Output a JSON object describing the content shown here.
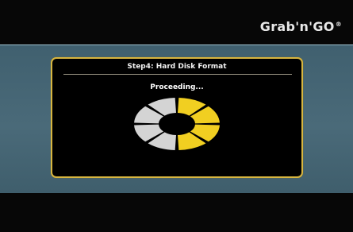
{
  "brand": {
    "name": "Grab'n'GO",
    "mark": "®"
  },
  "dialog": {
    "title": "Step4: Hard Disk Format",
    "status": "Proceeding..."
  },
  "spinner": {
    "segments": 8,
    "active_color": "#f1cf21",
    "inactive_color": "#d4d4d4",
    "active_segments": [
      0,
      1,
      2,
      3
    ],
    "inactive_segments": [
      4,
      5,
      6,
      7
    ]
  },
  "colors": {
    "background": "#070707",
    "stage": "#4a6a79",
    "dialog_border": "#d8b640",
    "dialog_bg": "#000000",
    "text": "#ffffff"
  }
}
